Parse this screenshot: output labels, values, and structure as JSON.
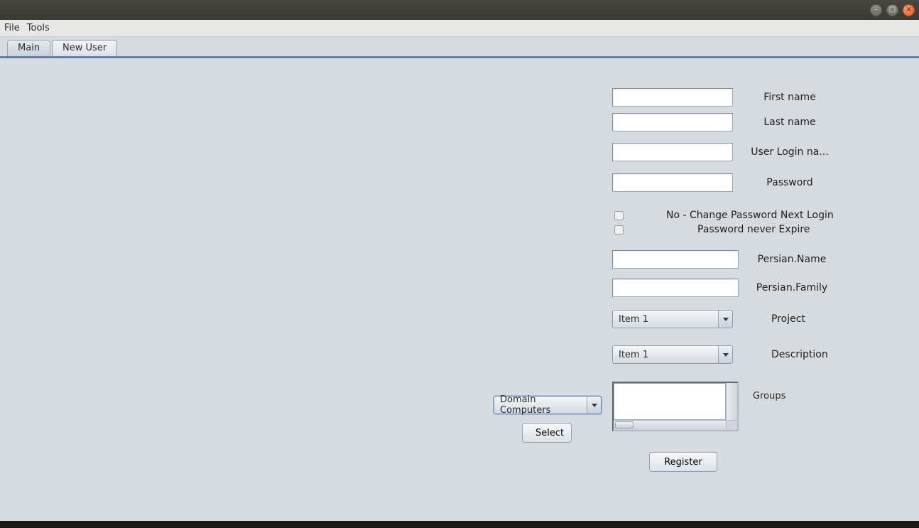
{
  "window": {
    "title": ""
  },
  "menu": {
    "file": "File",
    "tools": "Tools"
  },
  "tabs": {
    "main": "Main",
    "new_user": "New User",
    "active": "new_user"
  },
  "form": {
    "first_name": {
      "label": "First name",
      "value": ""
    },
    "last_name": {
      "label": "Last name",
      "value": ""
    },
    "user_login": {
      "label": "User Login na...",
      "value": ""
    },
    "password": {
      "label": "Password",
      "value": ""
    },
    "no_change_next_login": {
      "label": "No - Change Password Next Login",
      "checked": false
    },
    "pw_never_expire": {
      "label": "Password never Expire",
      "checked": false
    },
    "persian_name": {
      "label": "Persian.Name",
      "value": ""
    },
    "persian_family": {
      "label": "Persian.Family",
      "value": ""
    },
    "project": {
      "label": "Project",
      "selected": "Item 1"
    },
    "description": {
      "label": "Description",
      "selected": "Item 1"
    },
    "groups": {
      "label": "Groups"
    },
    "domain_select": {
      "selected": "Domain Computers"
    },
    "select_button": "Select",
    "register_button": "Register"
  }
}
